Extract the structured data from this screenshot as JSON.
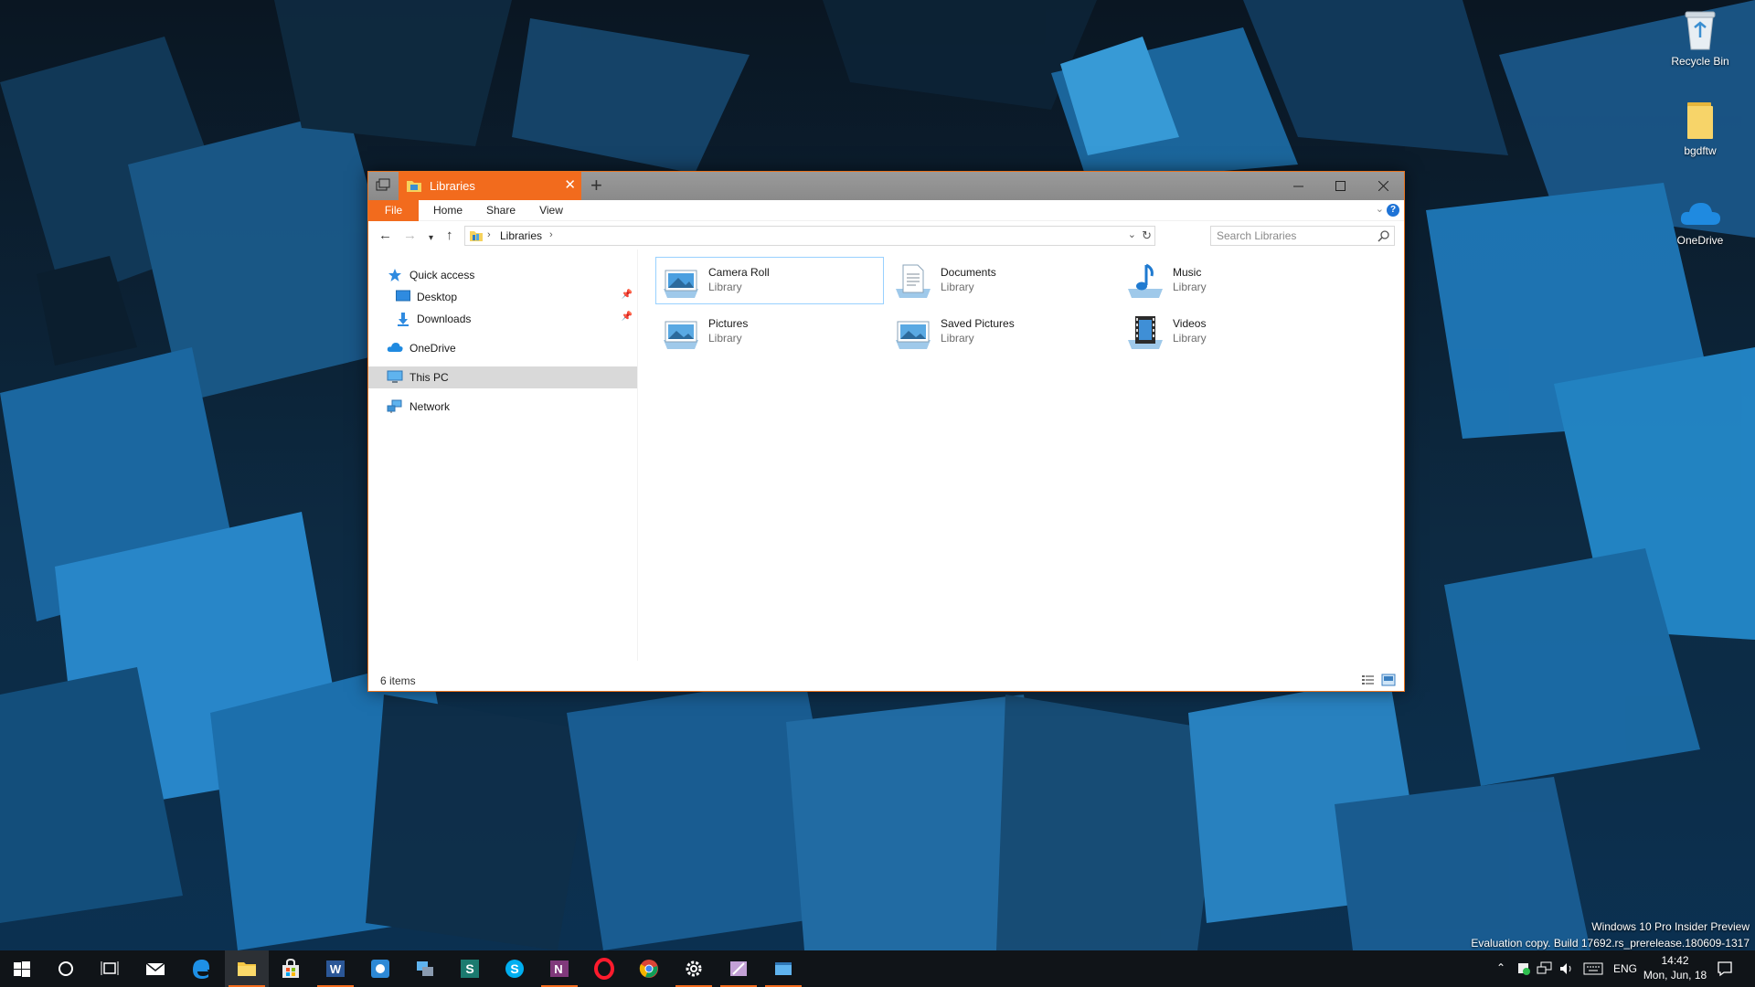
{
  "desktop": {
    "icons": [
      {
        "label": "Recycle Bin",
        "icon": "recycle-bin-icon"
      },
      {
        "label": "bgdftw",
        "icon": "folder-icon"
      },
      {
        "label": "OneDrive",
        "icon": "onedrive-cloud-icon"
      }
    ],
    "watermark": {
      "line1": "Windows 10 Pro Insider Preview",
      "line2": "Evaluation copy. Build 17692.rs_prerelease.180609-1317"
    }
  },
  "window": {
    "tab_title": "Libraries",
    "tab_close": "✕",
    "new_tab": "+",
    "accent_color": "#f26b1d",
    "ribbon": {
      "tabs": [
        "File",
        "Home",
        "Share",
        "View"
      ],
      "help": "?"
    },
    "address": {
      "crumb": "Libraries",
      "separator": "›"
    },
    "search": {
      "placeholder": "Search Libraries"
    },
    "nav": {
      "quick_access": "Quick access",
      "desktop": "Desktop",
      "downloads": "Downloads",
      "onedrive": "OneDrive",
      "this_pc": "This PC",
      "network": "Network"
    },
    "libraries": [
      {
        "name": "Camera Roll",
        "type": "Library",
        "icon": "camera-roll-library-icon"
      },
      {
        "name": "Documents",
        "type": "Library",
        "icon": "documents-library-icon"
      },
      {
        "name": "Music",
        "type": "Library",
        "icon": "music-library-icon"
      },
      {
        "name": "Pictures",
        "type": "Library",
        "icon": "pictures-library-icon"
      },
      {
        "name": "Saved Pictures",
        "type": "Library",
        "icon": "saved-pictures-library-icon"
      },
      {
        "name": "Videos",
        "type": "Library",
        "icon": "videos-library-icon"
      }
    ],
    "status": {
      "item_count": "6 items"
    }
  },
  "taskbar": {
    "tray_lang": "ENG",
    "clock_time": "14:42",
    "clock_date": "Mon, Jun, 18"
  }
}
